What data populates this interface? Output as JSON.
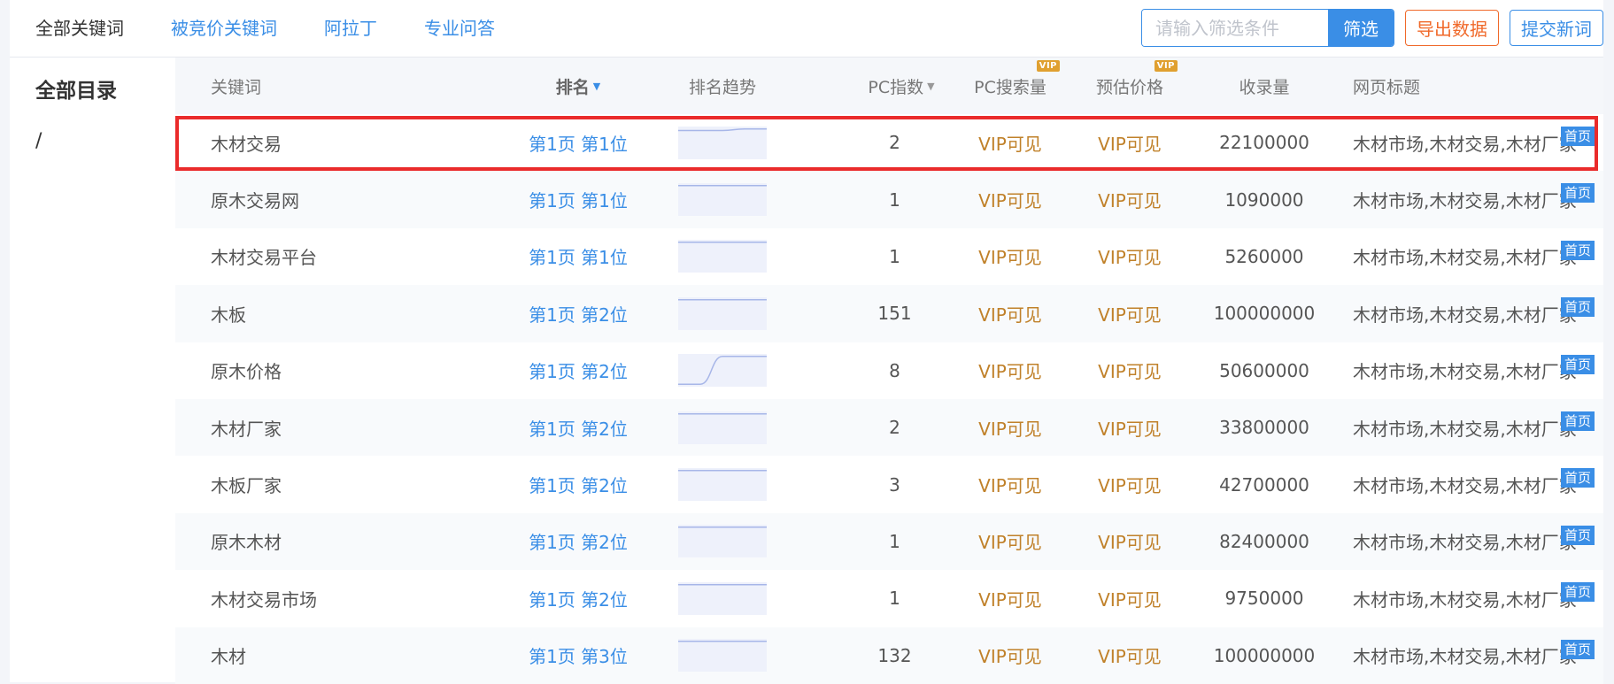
{
  "tabs": [
    "全部关键词",
    "被竞价关键词",
    "阿拉丁",
    "专业问答"
  ],
  "search": {
    "placeholder": "请输入筛选条件",
    "button": "筛选"
  },
  "actions": {
    "export": "导出数据",
    "submit": "提交新词"
  },
  "sidebar": {
    "title": "全部目录",
    "item": "/"
  },
  "columns": {
    "keyword": "关键词",
    "rank": "排名",
    "trend": "排名趋势",
    "pc_index": "PC指数",
    "pc_volume": "PC搜索量",
    "price": "预估价格",
    "indexed": "收录量",
    "title": "网页标题",
    "vip_badge": "VIP"
  },
  "rows": [
    {
      "keyword": "木材交易",
      "rank": "第1页 第1位",
      "pc_index": "2",
      "pc_volume": "VIP可见",
      "price": "VIP可见",
      "indexed": "22100000",
      "title": "木材市场,木材交易,木材厂家-",
      "badge": "首页",
      "trend": [
        0.1,
        0.1,
        0.1,
        0.05,
        0.05
      ]
    },
    {
      "keyword": "原木交易网",
      "rank": "第1页 第1位",
      "pc_index": "1",
      "pc_volume": "VIP可见",
      "price": "VIP可见",
      "indexed": "1090000",
      "title": "木材市场,木材交易,木材厂家-",
      "badge": "首页",
      "trend": [
        0.05,
        0.05,
        0.05,
        0.05,
        0.05
      ]
    },
    {
      "keyword": "木材交易平台",
      "rank": "第1页 第1位",
      "pc_index": "1",
      "pc_volume": "VIP可见",
      "price": "VIP可见",
      "indexed": "5260000",
      "title": "木材市场,木材交易,木材厂家-",
      "badge": "首页",
      "trend": [
        0.05,
        0.05,
        0.05,
        0.05,
        0.05
      ]
    },
    {
      "keyword": "木板",
      "rank": "第1页 第2位",
      "pc_index": "151",
      "pc_volume": "VIP可见",
      "price": "VIP可见",
      "indexed": "100000000",
      "title": "木材市场,木材交易,木材厂家-",
      "badge": "首页",
      "trend": [
        0.05,
        0.05,
        0.05,
        0.05,
        0.05
      ]
    },
    {
      "keyword": "原木价格",
      "rank": "第1页 第2位",
      "pc_index": "8",
      "pc_volume": "VIP可见",
      "price": "VIP可见",
      "indexed": "50600000",
      "title": "木材市场,木材交易,木材厂家-",
      "badge": "首页",
      "trend": [
        0.95,
        0.95,
        0.05,
        0.05,
        0.05
      ]
    },
    {
      "keyword": "木材厂家",
      "rank": "第1页 第2位",
      "pc_index": "2",
      "pc_volume": "VIP可见",
      "price": "VIP可见",
      "indexed": "33800000",
      "title": "木材市场,木材交易,木材厂家-",
      "badge": "首页",
      "trend": [
        0.05,
        0.05,
        0.05,
        0.05,
        0.05
      ]
    },
    {
      "keyword": "木板厂家",
      "rank": "第1页 第2位",
      "pc_index": "3",
      "pc_volume": "VIP可见",
      "price": "VIP可见",
      "indexed": "42700000",
      "title": "木材市场,木材交易,木材厂家-",
      "badge": "首页",
      "trend": [
        0.05,
        0.05,
        0.05,
        0.05,
        0.05
      ]
    },
    {
      "keyword": "原木木材",
      "rank": "第1页 第2位",
      "pc_index": "1",
      "pc_volume": "VIP可见",
      "price": "VIP可见",
      "indexed": "82400000",
      "title": "木材市场,木材交易,木材厂家-",
      "badge": "首页",
      "trend": [
        0.05,
        0.05,
        0.05,
        0.05,
        0.05
      ]
    },
    {
      "keyword": "木材交易市场",
      "rank": "第1页 第2位",
      "pc_index": "1",
      "pc_volume": "VIP可见",
      "price": "VIP可见",
      "indexed": "9750000",
      "title": "木材市场,木材交易,木材厂家-",
      "badge": "首页",
      "trend": [
        0.05,
        0.05,
        0.05,
        0.05,
        0.05
      ]
    },
    {
      "keyword": "木材",
      "rank": "第1页 第3位",
      "pc_index": "132",
      "pc_volume": "VIP可见",
      "price": "VIP可见",
      "indexed": "100000000",
      "title": "木材市场,木材交易,木材厂家-",
      "badge": "首页",
      "trend": [
        0.05,
        0.05,
        0.05,
        0.05,
        0.05
      ]
    }
  ],
  "colors": {
    "accent": "#3a8ee6",
    "export": "#f0692a",
    "vip_text": "#c0812a",
    "highlight": "#ea2b2b",
    "trend_line": "#a7b6e8",
    "trend_fill": "#eef1fb"
  }
}
